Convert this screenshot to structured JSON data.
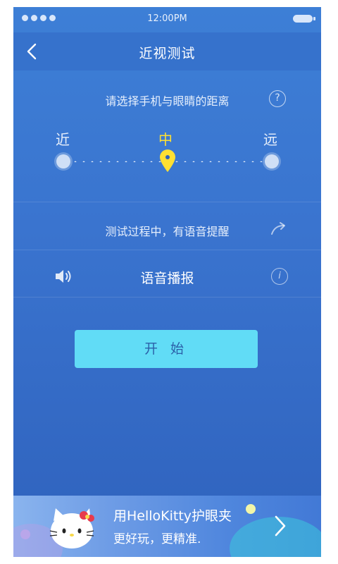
{
  "status_bar": {
    "time": "12:00PM"
  },
  "nav": {
    "title": "近视测试"
  },
  "distance": {
    "label": "请选择手机与眼睛的距离",
    "levels": {
      "near": "近",
      "mid": "中",
      "far": "远"
    },
    "selected": "中"
  },
  "reminder": {
    "text": "测试过程中，有语音提醒"
  },
  "voice": {
    "label": "语音播报"
  },
  "start_button": {
    "label": "开 始"
  },
  "banner": {
    "line1": "用HelloKitty护眼夹",
    "line2": "更好玩，更精准."
  },
  "icons": [
    "back-arrow-icon",
    "help-icon",
    "share-arrow-icon",
    "speaker-icon",
    "info-icon",
    "chevron-right-icon",
    "hello-kitty-icon",
    "location-pin-icon"
  ],
  "colors": {
    "accent": "#ffe033",
    "start_button": "#61dcf6",
    "background": "#3a74cf"
  }
}
